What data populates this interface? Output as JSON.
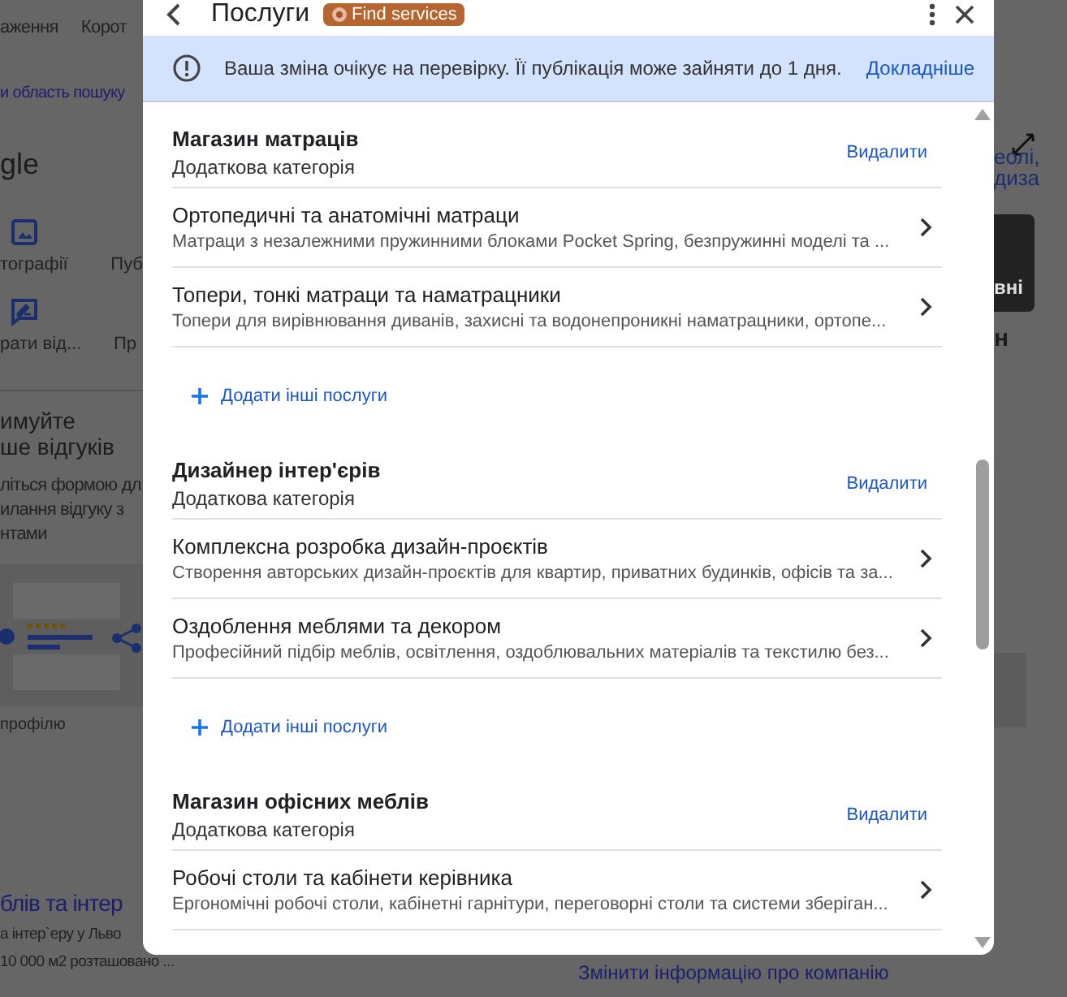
{
  "background": {
    "tabs": [
      "аження",
      "Корот"
    ],
    "search_area_link": "и область пошуку",
    "brand": "gle",
    "action_rows": [
      {
        "kind": "photo",
        "labels": [
          "тографії",
          "Пуб"
        ]
      },
      {
        "kind": "review",
        "labels": [
          "рати від...",
          "Пр"
        ]
      }
    ],
    "review_promo": {
      "title_lines": [
        "имуйте",
        "ше відгуків"
      ],
      "body_lines": [
        "літься формою дл",
        "илання відгуку з",
        "нтами"
      ],
      "caption": "профілю"
    },
    "listing": {
      "title": "блів та інтер",
      "lines": [
        "а інтер`еру у Льво",
        "10 000 м2 розташовано ..."
      ]
    },
    "right_panel": {
      "link_lines": [
        "еолі,",
        "диза"
      ],
      "image_caption": "вні",
      "heading": "н",
      "edit_link": "Змінити інформацію про компанію"
    }
  },
  "dialog": {
    "title": "Послуги",
    "badge": "Find services",
    "notice": {
      "text": "Ваша зміна очікує на перевірку. Її публікація може зайняти до 1 дня.",
      "link": "Докладніше"
    },
    "categories": [
      {
        "name": "Магазин матраців",
        "subtitle": "Додаткова категорія",
        "remove": "Видалити",
        "add": "Додати інші послуги",
        "services": [
          {
            "title": "Ортопедичні та анатомічні матраци",
            "description": "Матраци з незалежними пружинними блоками Pocket Spring, безпружинні моделі та ..."
          },
          {
            "title": "Топери, тонкі матраци та наматрацники",
            "description": "Топери для вирівнювання диванів, захисні та водонепроникні наматрацники, ортопе..."
          }
        ]
      },
      {
        "name": "Дизайнер інтер'єрів",
        "subtitle": "Додаткова категорія",
        "remove": "Видалити",
        "add": "Додати інші послуги",
        "services": [
          {
            "title": "Комплексна розробка дизайн-проєктів",
            "description": "Створення авторських дизайн-проєктів для квартир, приватних будинків, офісів та за..."
          },
          {
            "title": "Оздоблення меблями та декором",
            "description": "Професійний підбір меблів, освітлення, оздоблювальних матеріалів та текстилю без..."
          }
        ]
      },
      {
        "name": "Магазин офісних меблів",
        "subtitle": "Додаткова категорія",
        "remove": "Видалити",
        "services": [
          {
            "title": "Робочі столи та кабінети керівника",
            "description": "Ергономічні робочі столи, кабінетні гарнітури, переговорні столи та системи зберіган..."
          }
        ]
      }
    ]
  }
}
